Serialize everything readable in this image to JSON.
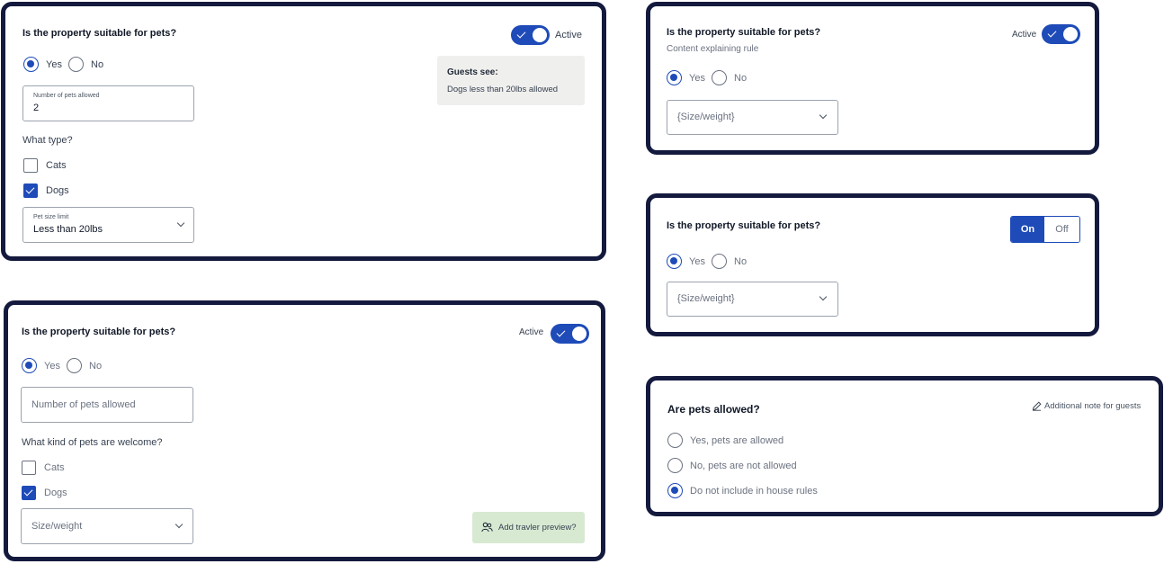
{
  "colors": {
    "accent": "#1e4bb8",
    "card_border": "#141a3d",
    "guest_box": "#efefed",
    "preview_button": "#d8e9d2"
  },
  "card1": {
    "question": "Is the property suitable for pets?",
    "toggle_label": "Active",
    "yes_label": "Yes",
    "no_label": "No",
    "pets_field_label": "Number of pets allowed",
    "pets_field_value": "2",
    "type_question": "What type?",
    "cats_label": "Cats",
    "dogs_label": "Dogs",
    "size_field_label": "Pet size limit",
    "size_field_value": "Less than 20lbs",
    "guests_see_title": "Guests see:",
    "guests_see_text": "Dogs less than 20lbs allowed"
  },
  "card2": {
    "question": "Is the property suitable for pets?",
    "toggle_label": "Active",
    "yes_label": "Yes",
    "no_label": "No",
    "pets_placeholder": "Number of pets allowed",
    "kind_question": "What kind of pets are welcome?",
    "cats_label": "Cats",
    "dogs_label": "Dogs",
    "size_placeholder": "Size/weight",
    "preview_label": "Add travler preview?",
    "preview_icon": "people-icon"
  },
  "card3": {
    "question": "Is the property suitable for pets?",
    "subtext": "Content explaining rule",
    "toggle_label": "Active",
    "yes_label": "Yes",
    "no_label": "No",
    "size_placeholder": "{Size/weight}"
  },
  "card4": {
    "question": "Is the property suitable for pets?",
    "on_label": "On",
    "off_label": "Off",
    "yes_label": "Yes",
    "no_label": "No",
    "size_placeholder": "{Size/weight}"
  },
  "card5": {
    "question": "Are pets allowed?",
    "note_label": "Additional note for guests",
    "note_icon": "pencil-icon",
    "options": [
      "Yes, pets are allowed",
      "No, pets are not allowed",
      "Do not include in house rules"
    ]
  }
}
